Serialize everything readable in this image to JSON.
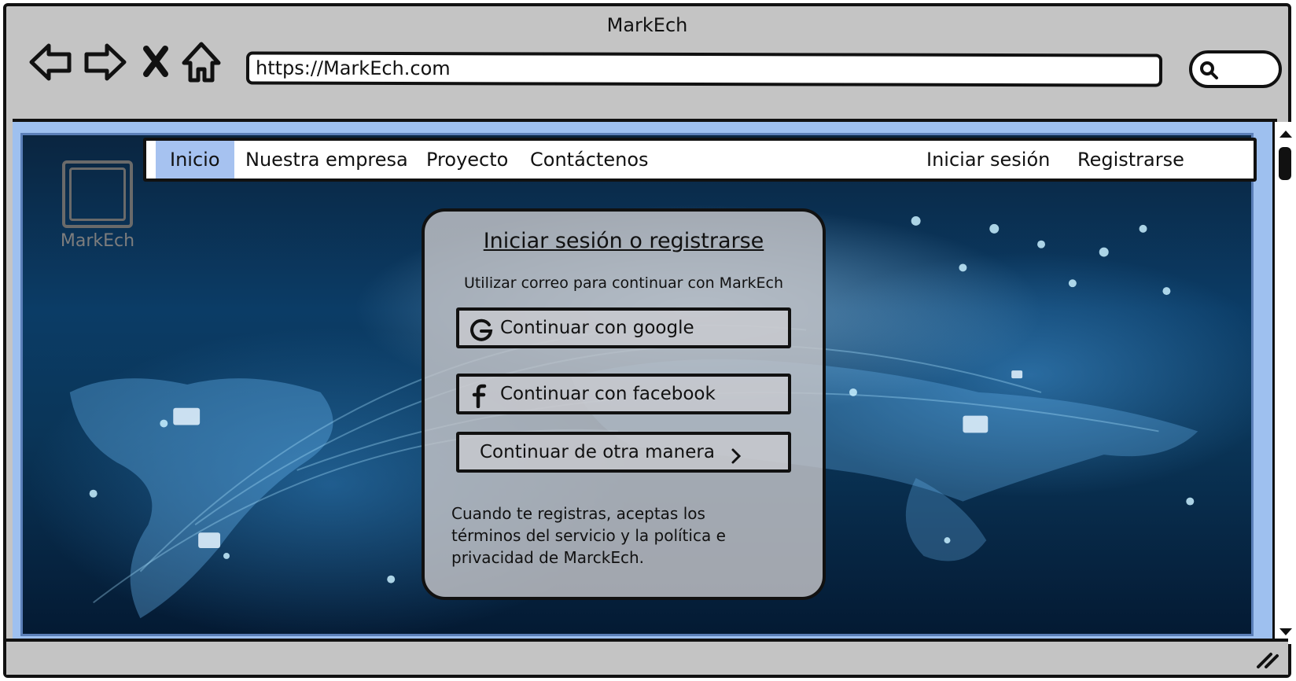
{
  "window": {
    "title": "MarkEch"
  },
  "toolbar": {
    "back_icon": "arrow-left-icon",
    "forward_icon": "arrow-right-icon",
    "stop_icon": "close-icon",
    "home_icon": "home-icon",
    "url": "https://MarkEch.com",
    "search_icon": "search-icon"
  },
  "site": {
    "logo_text": "MarkEch",
    "nav": {
      "items": [
        {
          "label": "Inicio",
          "active": true
        },
        {
          "label": "Nuestra empresa"
        },
        {
          "label": "Proyecto"
        },
        {
          "label": "Contáctenos"
        }
      ],
      "right": [
        {
          "label": "Iniciar sesión"
        },
        {
          "label": "Registrarse"
        }
      ],
      "active_color": "#a6c2f0"
    },
    "login": {
      "title": "Iniciar sesión o registrarse",
      "subtitle": "Utilizar correo para continuar con MarkEch",
      "google_label": "Continuar con google",
      "facebook_label": "Continuar con facebook",
      "other_label": "Continuar de otra manera",
      "terms": "Cuando te registras, aceptas los términos del servicio y la política e privacidad de MarckEch."
    }
  },
  "colors": {
    "chrome": "#c4c4c4",
    "viewport_frame": "#9ec0ef"
  }
}
